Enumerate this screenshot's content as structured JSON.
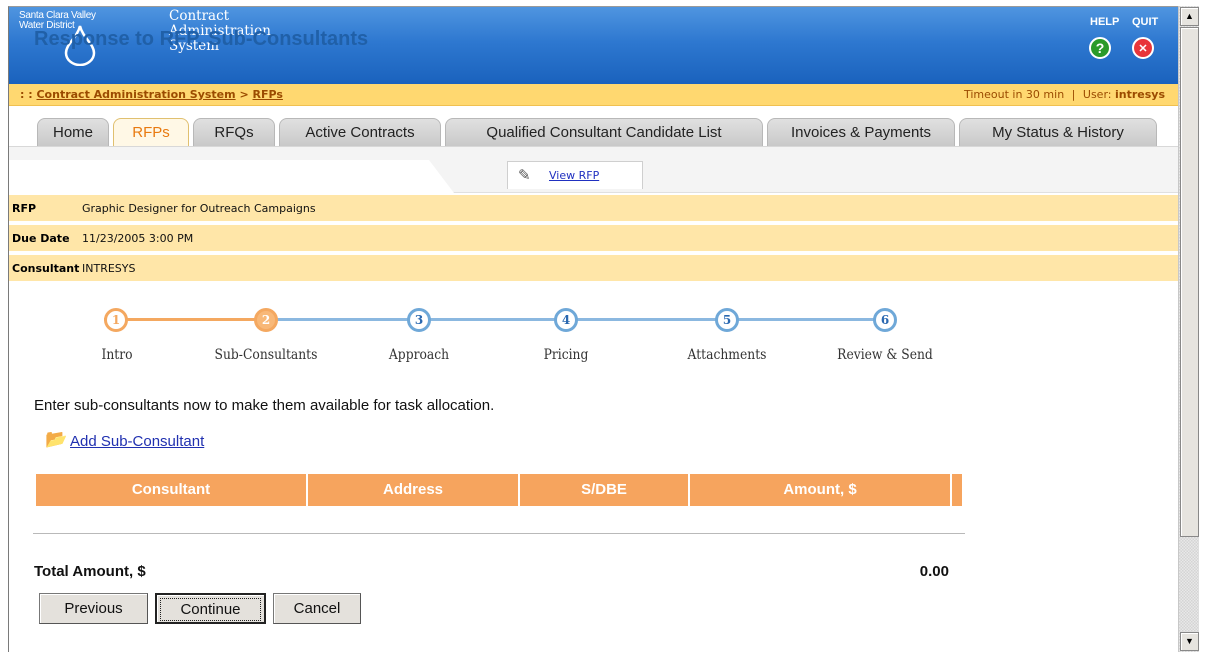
{
  "header": {
    "org_line1": "Santa Clara Valley",
    "org_line2": "Water District",
    "system_line1": "Contract",
    "system_line2": "Administration",
    "system_line3": "System",
    "help_label": "HELP",
    "quit_label": "QUIT",
    "help_icon": "?",
    "quit_icon": "✕"
  },
  "breadcrumb": {
    "prefix": ": :",
    "root": "Contract Administration System",
    "separator": ">",
    "current": "RFPs",
    "timeout": "Timeout in 30 min",
    "divider": "|",
    "user_label": "User:",
    "user": "intresys"
  },
  "tabs": [
    {
      "label": "Home"
    },
    {
      "label": "RFPs"
    },
    {
      "label": "RFQs"
    },
    {
      "label": "Active Contracts"
    },
    {
      "label": "Qualified Consultant Candidate List"
    },
    {
      "label": "Invoices & Payments"
    },
    {
      "label": "My Status & History"
    }
  ],
  "page": {
    "title": "Response to RFP. Sub-Consultants",
    "view_rfp": "View RFP"
  },
  "info": {
    "rfp_label": "RFP",
    "rfp_value": "Graphic Designer for Outreach Campaigns",
    "due_label": "Due Date",
    "due_value": "11/23/2005 3:00 PM",
    "consultant_label": "Consultant",
    "consultant_value": "INTRESYS"
  },
  "wizard": {
    "steps": [
      {
        "num": "1",
        "label": "Intro",
        "state": "done"
      },
      {
        "num": "2",
        "label": "Sub-Consultants",
        "state": "current"
      },
      {
        "num": "3",
        "label": "Approach",
        "state": "todo"
      },
      {
        "num": "4",
        "label": "Pricing",
        "state": "todo"
      },
      {
        "num": "5",
        "label": "Attachments",
        "state": "todo"
      },
      {
        "num": "6",
        "label": "Review & Send",
        "state": "todo"
      }
    ]
  },
  "main": {
    "instruction": "Enter sub-consultants now to make them available for task allocation.",
    "add_link": "Add Sub-Consultant",
    "columns": [
      "Consultant",
      "Address",
      "S/DBE",
      "Amount, $"
    ],
    "total_label": "Total Amount, $",
    "total_value": "0.00"
  },
  "buttons": {
    "previous": "Previous",
    "continue": "Continue",
    "cancel": "Cancel"
  },
  "colors": {
    "header_blue": "#1a62bd",
    "crumb_bg": "#ffd870",
    "info_bg": "#ffe6a8",
    "table_header": "#f6a45e",
    "title_blue": "#2060a8",
    "active_tab_text": "#e87a10"
  }
}
